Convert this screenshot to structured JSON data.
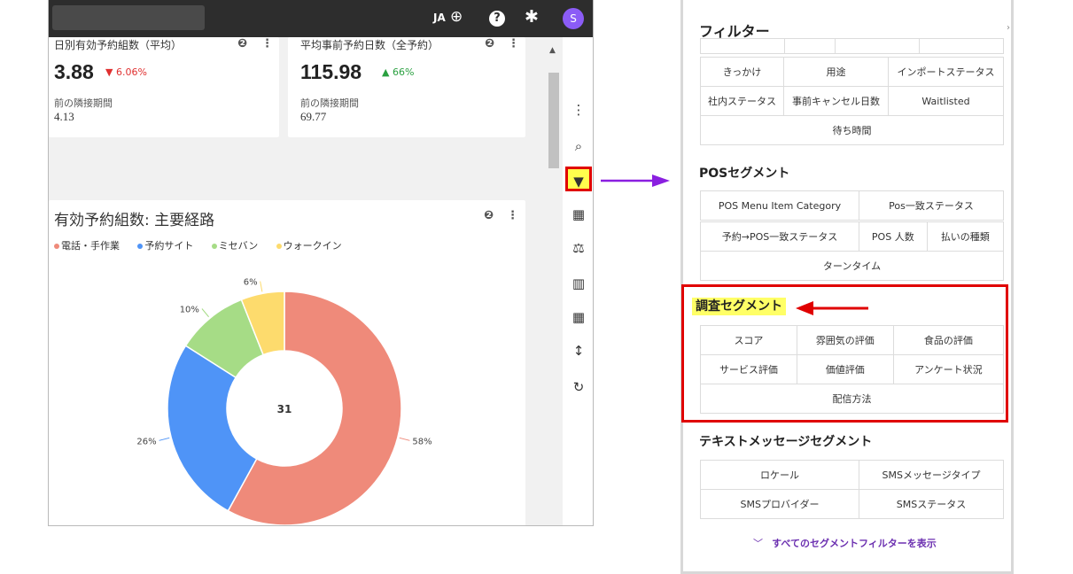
{
  "topbar": {
    "lang": "JA",
    "avatar": "S"
  },
  "kpis": [
    {
      "title": "日別有効予約組数（平均）",
      "value": "3.88",
      "change": "6.06%",
      "prev_label": "前の隣接期間",
      "prev_value": "4.13"
    },
    {
      "title": "平均事前予約日数（全予約）",
      "value": "115.98",
      "change": "66%",
      "prev_label": "前の隣接期間",
      "prev_value": "69.77"
    }
  ],
  "chart_card": {
    "title": "有効予約組数: 主要経路",
    "center_value": "31"
  },
  "chart_data": {
    "type": "pie",
    "categories": [
      "電話・手作業",
      "予約サイト",
      "ミセバン",
      "ウォークイン"
    ],
    "values": [
      58,
      26,
      10,
      6
    ],
    "labels": [
      "58%",
      "26%",
      "10%",
      "6%"
    ],
    "colors": [
      "#ef8a7a",
      "#4f94f7",
      "#a6dc86",
      "#fddb6d"
    ],
    "title": "有効予約組数: 主要経路",
    "legend_position": "top-left"
  },
  "filter_panel": {
    "title": "フィルター",
    "top_rows": [
      [
        "きっかけ",
        "用途",
        "インポートステータス"
      ],
      [
        "社内ステータス",
        "事前キャンセル日数",
        "Waitlisted"
      ]
    ],
    "top_full": "待ち時間",
    "pos": {
      "title": "POSセグメント",
      "row1": [
        "POS Menu Item Category",
        "Pos一致ステータス"
      ],
      "row2": [
        "予約→POS一致ステータス",
        "POS 人数",
        "払いの種類"
      ],
      "full": "ターンタイム"
    },
    "survey": {
      "title": "調査セグメント",
      "rows": [
        [
          "スコア",
          "雰囲気の評価",
          "食品の評価"
        ],
        [
          "サービス評価",
          "価値評価",
          "アンケート状況"
        ]
      ],
      "full": "配信方法"
    },
    "sms": {
      "title": "テキストメッセージセグメント",
      "rows": [
        [
          "ロケール",
          "SMSメッセージタイプ"
        ],
        [
          "SMSプロバイダー",
          "SMSステータス"
        ]
      ]
    },
    "show_all": "すべてのセグメントフィルターを表示"
  }
}
